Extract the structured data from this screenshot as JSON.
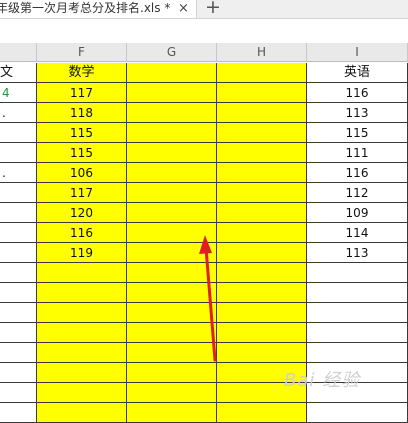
{
  "tab": {
    "title": "年级第一次月考总分及排名.xls *",
    "close_icon": "close-icon",
    "new_icon": "plus-icon"
  },
  "columns": [
    "F",
    "G",
    "H",
    "I"
  ],
  "header_row": {
    "e": "文",
    "f": "数学",
    "g": "",
    "h": "",
    "i": "英语"
  },
  "rows": [
    {
      "e": "",
      "f": "117",
      "i": "116",
      "mark": "green"
    },
    {
      "e": "",
      "f": "118",
      "i": "113",
      "mark": "dot"
    },
    {
      "e": "",
      "f": "115",
      "i": "115",
      "mark": ""
    },
    {
      "e": "",
      "f": "115",
      "i": "111",
      "mark": ""
    },
    {
      "e": "",
      "f": "106",
      "i": "116",
      "mark": "dot"
    },
    {
      "e": "",
      "f": "117",
      "i": "112",
      "mark": ""
    },
    {
      "e": "",
      "f": "120",
      "i": "109",
      "mark": ""
    },
    {
      "e": "",
      "f": "116",
      "i": "114",
      "mark": ""
    },
    {
      "e": "",
      "f": "119",
      "i": "113",
      "mark": ""
    },
    {
      "e": "",
      "f": "",
      "i": "",
      "mark": ""
    },
    {
      "e": "",
      "f": "",
      "i": "",
      "mark": ""
    },
    {
      "e": "",
      "f": "",
      "i": "",
      "mark": ""
    },
    {
      "e": "",
      "f": "",
      "i": "",
      "mark": ""
    },
    {
      "e": "",
      "f": "",
      "i": "",
      "mark": ""
    },
    {
      "e": "",
      "f": "",
      "i": "",
      "mark": ""
    },
    {
      "e": "",
      "f": "",
      "i": "",
      "mark": ""
    },
    {
      "e": "",
      "f": "",
      "i": "",
      "mark": ""
    }
  ],
  "annotation": {
    "type": "red-arrow",
    "color": "#e02020"
  },
  "watermark": "Bai 经验"
}
